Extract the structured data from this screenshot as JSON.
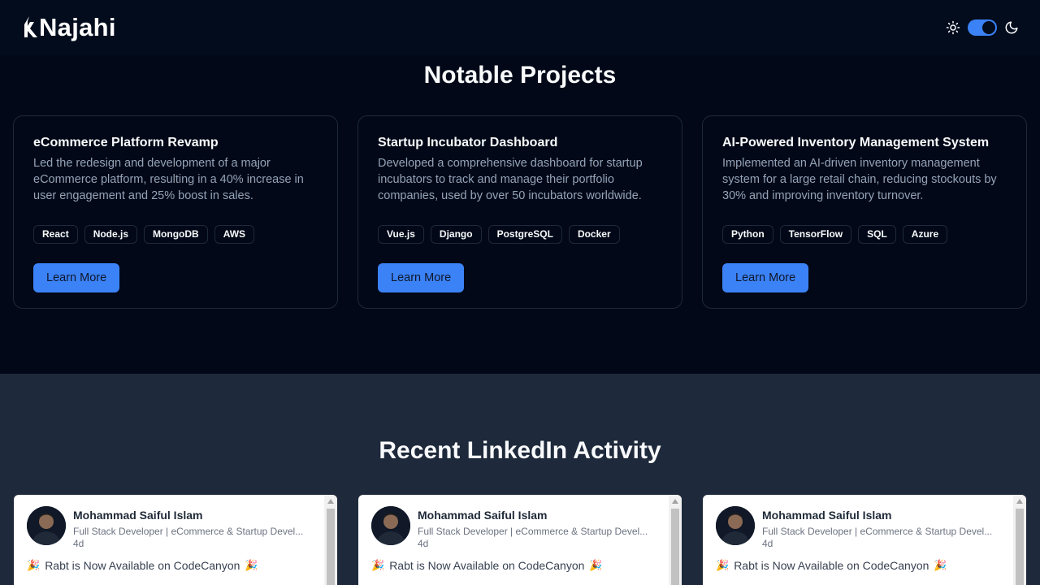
{
  "header": {
    "brand": "Najahi",
    "icons": {
      "light": "sun-icon",
      "dark": "moon-icon"
    },
    "theme_toggle_on": true
  },
  "projects": {
    "title": "Notable Projects",
    "items": [
      {
        "title": "eCommerce Platform Revamp",
        "description": "Led the redesign and development of a major eCommerce platform, resulting in a 40% increase in user engagement and 25% boost in sales.",
        "tags": [
          "React",
          "Node.js",
          "MongoDB",
          "AWS"
        ],
        "button": "Learn More"
      },
      {
        "title": "Startup Incubator Dashboard",
        "description": "Developed a comprehensive dashboard for startup incubators to track and manage their portfolio companies, used by over 50 incubators worldwide.",
        "tags": [
          "Vue.js",
          "Django",
          "PostgreSQL",
          "Docker"
        ],
        "button": "Learn More"
      },
      {
        "title": "AI-Powered Inventory Management System",
        "description": "Implemented an AI-driven inventory management system for a large retail chain, reducing stockouts by 30% and improving inventory turnover.",
        "tags": [
          "Python",
          "TensorFlow",
          "SQL",
          "Azure"
        ],
        "button": "Learn More"
      }
    ]
  },
  "linkedin": {
    "title": "Recent LinkedIn Activity",
    "posts": [
      {
        "name": "Mohammad Saiful Islam",
        "headline": "Full Stack Developer | eCommerce & Startup Devel...",
        "time": "4d",
        "text": "Rabt is Now Available on CodeCanyon",
        "emoji": "🎉"
      },
      {
        "name": "Mohammad Saiful Islam",
        "headline": "Full Stack Developer | eCommerce & Startup Devel...",
        "time": "4d",
        "text": "Rabt is Now Available on CodeCanyon",
        "emoji": "🎉"
      },
      {
        "name": "Mohammad Saiful Islam",
        "headline": "Full Stack Developer | eCommerce & Startup Devel...",
        "time": "4d",
        "text": "Rabt is Now Available on CodeCanyon",
        "emoji": "🎉"
      }
    ]
  },
  "colors": {
    "accent": "#3b82f6",
    "background": "#020817",
    "header": "#030c1d",
    "section_alt": "#1e293b",
    "muted_text": "#94a3b8"
  }
}
